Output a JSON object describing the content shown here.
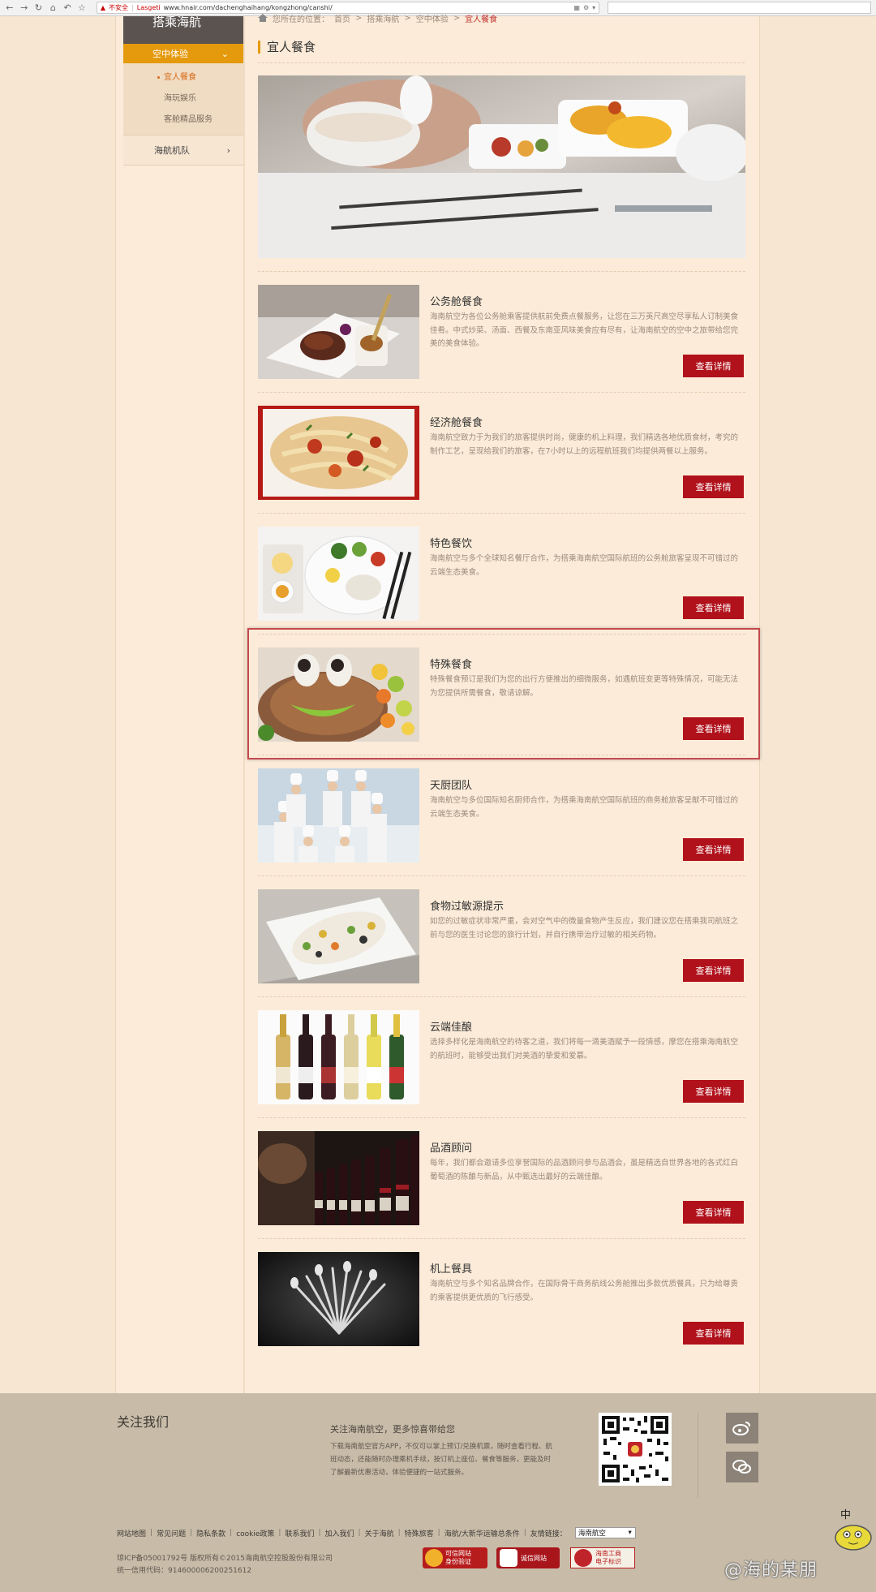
{
  "browser": {
    "insecure": "不安全",
    "tag": "Lasgeti",
    "url": "www.hnair.com/dachenghaihang/kongzhong/canshi/"
  },
  "sidebar": {
    "header": "搭乘海航",
    "active": "空中体验",
    "subitems": [
      "宜人餐食",
      "海玩娱乐",
      "客舱精品服务"
    ],
    "item": "海航机队"
  },
  "breadcrumb": {
    "prefix": "您所在的位置：",
    "home": "首页",
    "level1": "搭乘海航",
    "level2": "空中体验",
    "current": "宜人餐食"
  },
  "page_title": "宜人餐食",
  "button_label": "查看详情",
  "items": [
    {
      "title": "公务舱餐食",
      "desc": "海南航空为各位公务舱乘客提供航前免费点餐服务，让您在三万英尺高空尽享私人订制美食佳肴。中式炒菜、汤面、西餐及东南亚风味美食应有尽有，让海南航空的空中之旅带给您完美的美食体验。"
    },
    {
      "title": "经济舱餐食",
      "desc": "海南航空致力于为我们的旅客提供时尚，健康的机上料理，我们精选各地优质食材，考究的制作工艺，呈现给我们的旅客，在7小时以上的远程航班我们均提供两餐以上服务。"
    },
    {
      "title": "特色餐饮",
      "desc": "海南航空与多个全球知名餐厅合作，为搭乘海南航空国际航班的公务舱旅客呈现不可错过的云端生态美食。"
    },
    {
      "title": "特殊餐食",
      "desc": "特殊餐食预订是我们为您的出行方便推出的细微服务，如遇航班变更等特殊情况，可能无法为您提供所需餐食，敬请谅解。"
    },
    {
      "title": "天厨团队",
      "desc": "海南航空与多位国际知名厨师合作，为搭乘海南航空国际航班的商务舱旅客呈献不可错过的云端生态美食。"
    },
    {
      "title": "食物过敏源提示",
      "desc": "如您的过敏症状非常严重，会对空气中的微量食物产生反应，我们建议您在搭乘我司航班之前与您的医生讨论您的旅行计划，并自行携带治疗过敏的相关药物。"
    },
    {
      "title": "云端佳酿",
      "desc": "选择多样化是海南航空的待客之道，我们将每一滴美酒赋予一段情感，摩您在搭乘海南航空的航班时，能够受出我们对美酒的挚爱和爱慕。"
    },
    {
      "title": "品酒顾问",
      "desc": "每年，我们都会邀请多位享誉国际的品酒顾问参与品酒会，虽是精选自世界各地的各式红白葡萄酒的陈酿与新品，从中甄选出最好的云端佳酿。"
    },
    {
      "title": "机上餐具",
      "desc": "海南航空与多个知名品牌合作，在国际骨干商务航线公务舱推出多款优质餐具，只为给尊贵的乘客提供更优质的飞行感受。"
    }
  ],
  "footer": {
    "title": "关注我们",
    "heading": "关注海南航空，更多惊喜带给您",
    "desc": "下载海南航空官方APP，不仅可以掌上预订/兑换机票，随时查看行程、航班动态，还能随时办理乘机手续，按订机上座位、餐食等服务，更能及时了解最新优惠活动，体验便捷的一站式服务。",
    "links": [
      "网站地图",
      "常见问题",
      "隐私条款",
      "cookie政策",
      "联系我们",
      "加入我们",
      "关于海航",
      "特殊旅客",
      "海航/大新华运输总条件",
      "友情链接："
    ],
    "select_value": "海南航空",
    "copyright": "琼ICP备05001792号 版权所有©2015海南航空控股股份有限公司",
    "credit_code": "统一信用代码：914600006200251612",
    "badges": [
      "可信网站",
      "身份验证",
      "诚信网站",
      "海南工商",
      "电子标识"
    ]
  },
  "watermark": "@海的某朋",
  "watermark_glyph": "中"
}
